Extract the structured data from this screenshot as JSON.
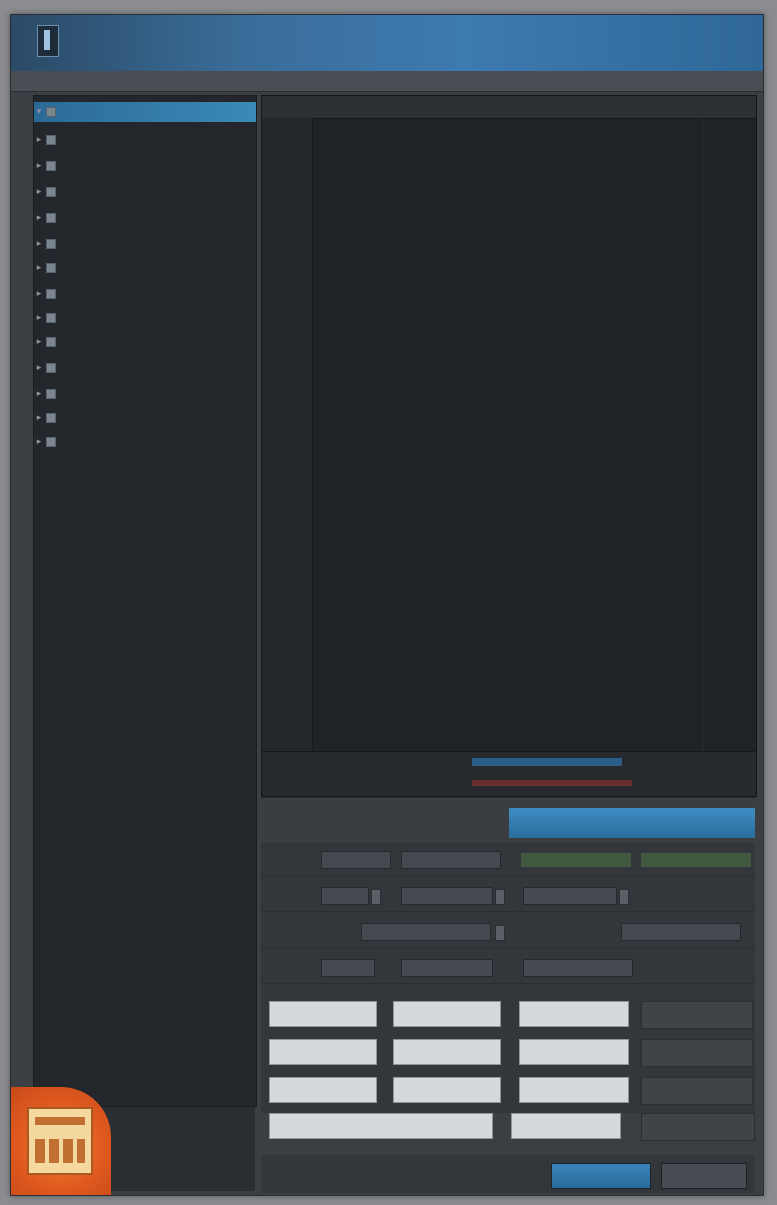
{
  "window": {
    "title": "",
    "subtitle": ""
  },
  "menu": {
    "items": [
      ""
    ]
  },
  "sidebar": {
    "items": [
      {
        "label": "",
        "selected": true
      },
      {
        "label": ""
      },
      {
        "label": ""
      },
      {
        "label": ""
      },
      {
        "label": ""
      },
      {
        "label": ""
      },
      {
        "label": ""
      },
      {
        "label": ""
      },
      {
        "label": ""
      },
      {
        "label": ""
      },
      {
        "label": ""
      },
      {
        "label": ""
      },
      {
        "label": ""
      },
      {
        "label": ""
      }
    ]
  },
  "editor": {
    "columns": [
      "",
      ""
    ],
    "rows": [
      ""
    ]
  },
  "tabs": [
    {
      "label": "",
      "active": false
    },
    {
      "label": "",
      "active": true
    }
  ],
  "props": {
    "rows": [
      {
        "label": "",
        "field1": "",
        "field2": "",
        "tag1": "",
        "tag2": ""
      },
      {
        "label": "",
        "field1": "",
        "field2": "",
        "field3": ""
      },
      {
        "label": "",
        "field1": "",
        "field2": ""
      },
      {
        "label": "",
        "field1": "",
        "field2": "",
        "field3": ""
      }
    ]
  },
  "grid": {
    "rows": [
      [
        "",
        "",
        ""
      ],
      [
        "",
        "",
        ""
      ],
      [
        "",
        "",
        ""
      ],
      [
        "",
        "",
        ""
      ]
    ]
  },
  "footer": {
    "links": [
      "",
      ""
    ],
    "note": "",
    "ok_label": "",
    "cancel_label": ""
  },
  "colors": {
    "accent": "#3a84bb",
    "title_bar": "#3a6c98",
    "editor_bg": "#1f2327",
    "badge": "#e05a20"
  }
}
